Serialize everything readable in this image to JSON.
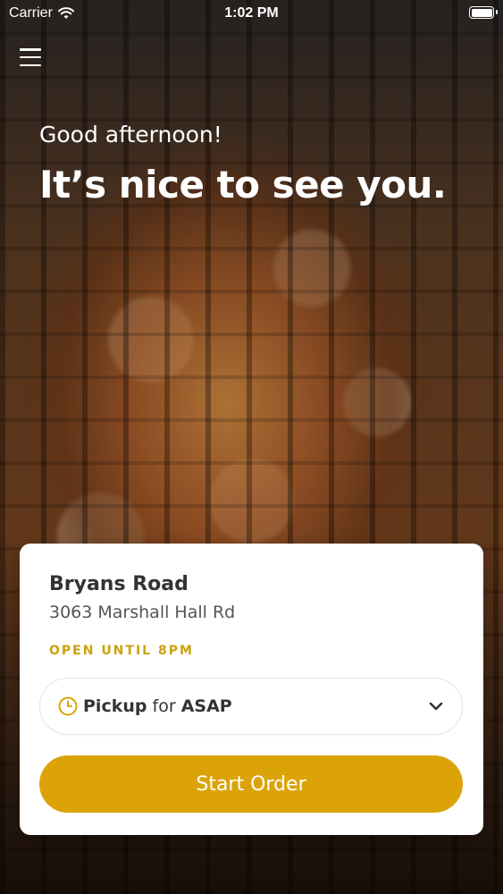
{
  "status_bar": {
    "carrier": "Carrier",
    "time": "1:02 PM",
    "wifi_icon": "wifi-icon",
    "battery_icon": "battery-icon"
  },
  "header": {
    "menu_icon": "hamburger-menu-icon",
    "greeting": "Good afternoon!",
    "headline": "It’s nice to see you."
  },
  "store_card": {
    "name": "Bryans Road",
    "address": "3063 Marshall Hall Rd",
    "hours": "OPEN UNTIL 8PM",
    "order_mode": {
      "icon": "clock-icon",
      "mode": "Pickup",
      "connector": "for",
      "time": "ASAP",
      "dropdown_icon": "chevron-down-icon"
    },
    "start_button_label": "Start Order"
  },
  "colors": {
    "accent": "#dba308",
    "hours_text": "#c9a30a",
    "card_bg": "#ffffff"
  }
}
